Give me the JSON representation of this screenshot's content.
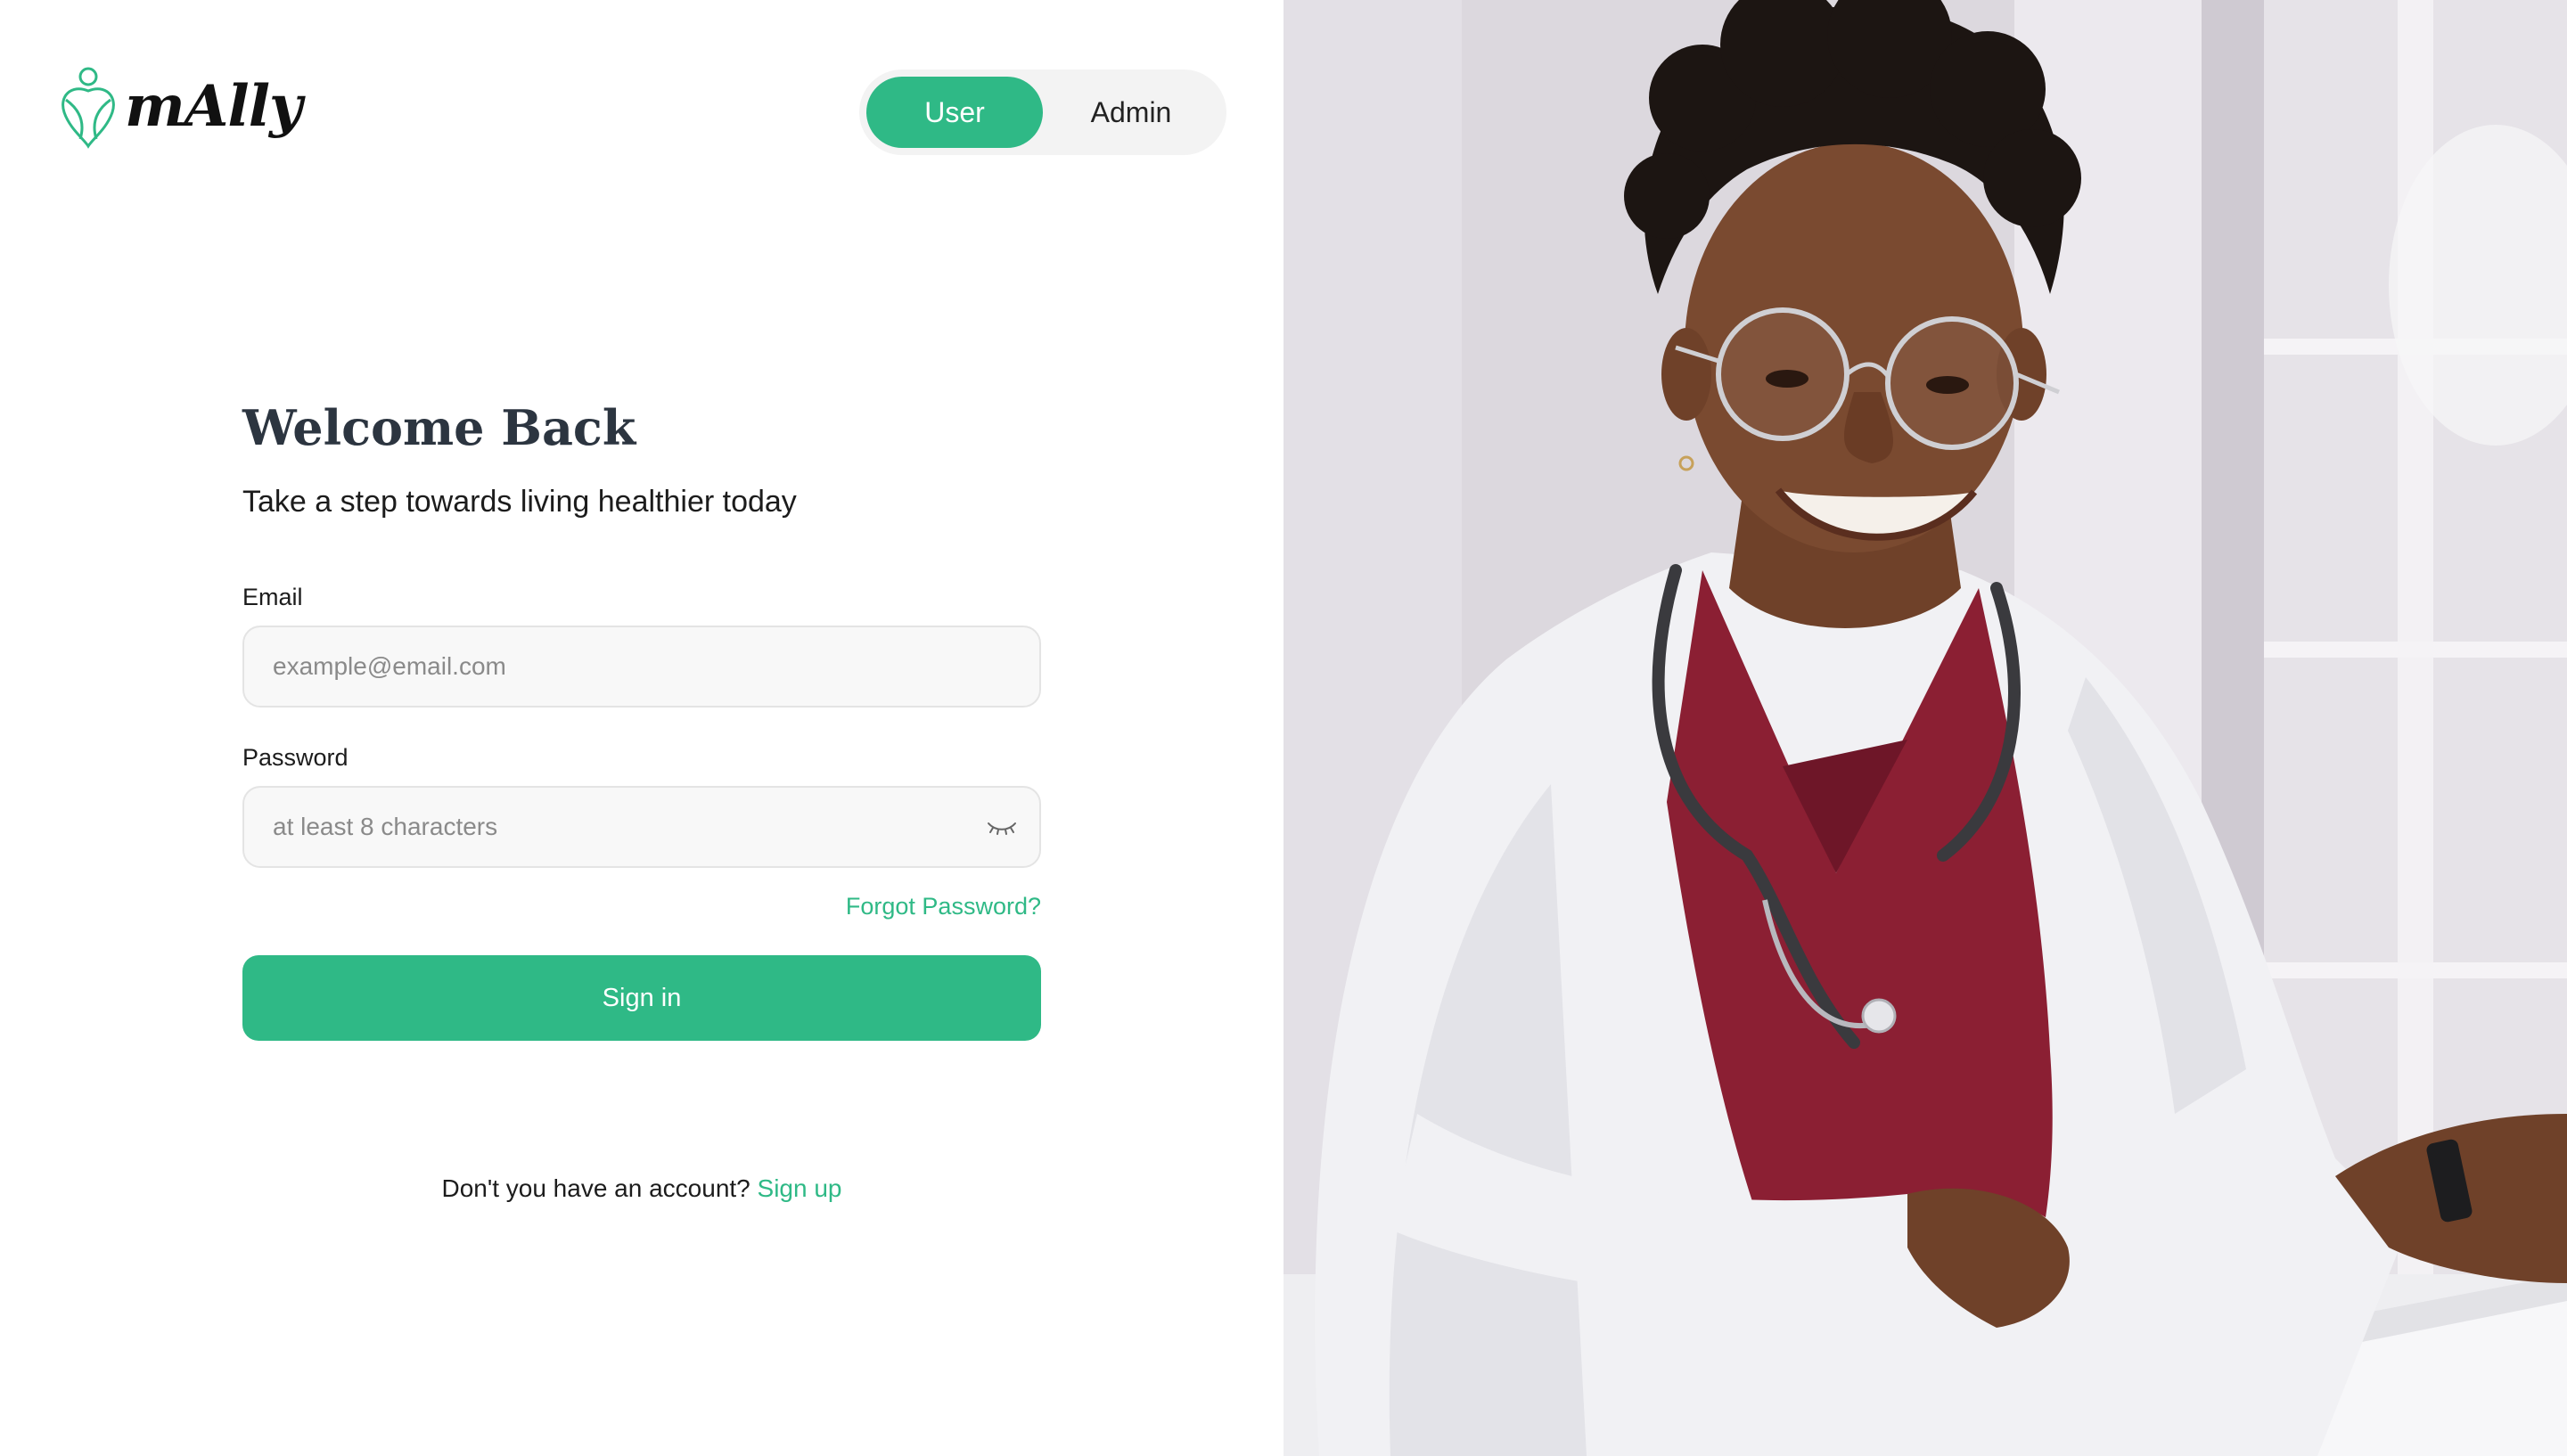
{
  "brand": {
    "name": "mAlly",
    "accent_color": "#2fb986",
    "logo_icon": "heart-figure-logo"
  },
  "role_toggle": {
    "options": [
      "User",
      "Admin"
    ],
    "selected": "User"
  },
  "form": {
    "title": "Welcome Back",
    "subtitle": "Take a step towards living healthier today",
    "email": {
      "label": "Email",
      "value": "",
      "placeholder": "example@email.com"
    },
    "password": {
      "label": "Password",
      "value": "",
      "placeholder": "at least 8 characters",
      "toggle_icon": "eye-closed-icon"
    },
    "forgot_password": "Forgot Password?",
    "submit_label": "Sign in",
    "signup_prompt": "Don't you have an account?",
    "signup_link": "Sign up"
  },
  "hero_image": {
    "subject": "smiling-doctor-photo",
    "colors": {
      "background": "#dedadf",
      "coat": "#f2f2f4",
      "scrubs": "#8a1f32",
      "skin": "#7a4a30"
    }
  }
}
